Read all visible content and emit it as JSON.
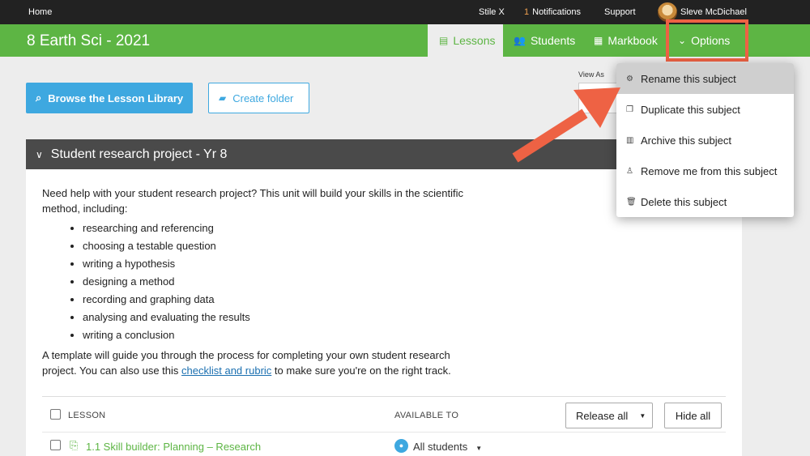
{
  "topbar": {
    "home": "Home",
    "stile_x": "Stile X",
    "notifications_count": "1",
    "notifications": "Notifications",
    "support": "Support",
    "user_name": "Sleve McDichael"
  },
  "subject": {
    "title": "8 Earth Sci - 2021",
    "tabs": [
      {
        "label": "Lessons",
        "icon": "document-icon"
      },
      {
        "label": "Students",
        "icon": "users-icon"
      },
      {
        "label": "Markbook",
        "icon": "grid-icon"
      },
      {
        "label": "Options",
        "icon": "chevron-circle-icon"
      }
    ]
  },
  "actions": {
    "browse_label": "Browse the Lesson Library",
    "create_folder_label": "Create folder",
    "view_as_label": "View As"
  },
  "unit": {
    "title": "Student research project - Yr 8",
    "intro": "Need help with your student research project? This unit will build your skills in the scientific method, including:",
    "bullets": [
      "researching and referencing",
      "choosing a testable question",
      "writing a hypothesis",
      "designing a method",
      "recording and graphing data",
      "analysing and evaluating the results",
      "writing a conclusion"
    ],
    "outro_before_link": "A template will guide you through the process for completing your own student research project. You can also use this ",
    "link_text": "checklist and rubric",
    "outro_after_link": " to make sure you're on the right track."
  },
  "table": {
    "col_lesson": "LESSON",
    "col_available": "AVAILABLE TO",
    "release_all": "Release all",
    "hide_all": "Hide all",
    "rows": [
      {
        "lesson": "1.1 Skill builder: Planning – Research",
        "available": "All students"
      }
    ]
  },
  "options_menu": {
    "items": [
      {
        "label": "Rename this subject",
        "icon": "gear-icon"
      },
      {
        "label": "Duplicate this subject",
        "icon": "copy-icon"
      },
      {
        "label": "Archive this subject",
        "icon": "archive-icon"
      },
      {
        "label": "Remove me from this subject",
        "icon": "user-icon"
      },
      {
        "label": "Delete this subject",
        "icon": "trash-icon"
      }
    ]
  },
  "colors": {
    "brand_green": "#5db544",
    "accent_blue": "#3ea8e0",
    "highlight_orange": "#ee6244",
    "topbar": "#222222"
  }
}
